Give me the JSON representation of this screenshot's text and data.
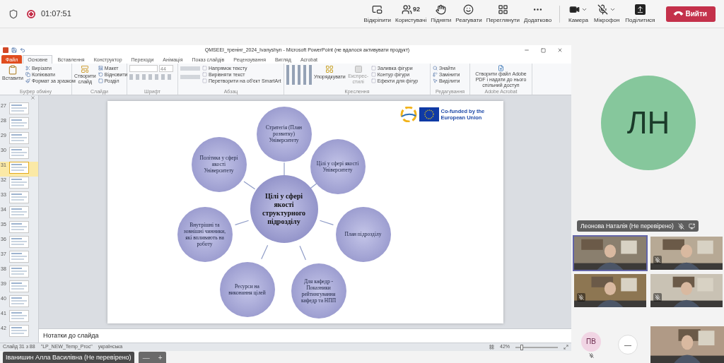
{
  "call_bar": {
    "timer": "01:07:51",
    "recording": true,
    "participant_count": "92",
    "actions": [
      "Відкріпити",
      "Користувачі",
      "Підняти",
      "Реагувати",
      "Переглянути",
      "Додатково"
    ],
    "devices": [
      {
        "label": "Камера",
        "off": false
      },
      {
        "label": "Мікрофон",
        "off": true
      },
      {
        "label": "Поділитися",
        "off": false
      }
    ],
    "leave": "Вийти"
  },
  "powerpoint": {
    "title": "QMSEEI_тренінг_2024_Ivanyshyn - Microsoft PowerPoint (не вдалося активувати продукт)",
    "tabs": [
      {
        "label": "Файл",
        "kind": "file",
        "selected": false
      },
      {
        "label": "Основне",
        "kind": "tab",
        "selected": true
      },
      {
        "label": "Вставлення",
        "kind": "tab",
        "selected": false
      },
      {
        "label": "Конструктор",
        "kind": "tab",
        "selected": false
      },
      {
        "label": "Переходи",
        "kind": "tab",
        "selected": false
      },
      {
        "label": "Анімація",
        "kind": "tab",
        "selected": false
      },
      {
        "label": "Показ слайдів",
        "kind": "tab",
        "selected": false
      },
      {
        "label": "Рецензування",
        "kind": "tab",
        "selected": false
      },
      {
        "label": "Вигляд",
        "kind": "tab",
        "selected": false
      },
      {
        "label": "Acrobat",
        "kind": "tab",
        "selected": false
      }
    ],
    "ribbon": {
      "clipboard": {
        "paste": "Вставити",
        "items": [
          "Вирізати",
          "Копіювати",
          "Формат за зразком"
        ],
        "group": "Буфер обміну"
      },
      "slides": {
        "new_slide": "Створити слайд",
        "items": [
          "Макет",
          "Відновити",
          "Розділ"
        ],
        "group": "Слайди"
      },
      "font": {
        "size": "44",
        "group": "Шрифт"
      },
      "paragraph": {
        "items": [
          "Напрямок тексту",
          "Вирівняти текст",
          "Перетворити на об'єкт SmartArt"
        ],
        "group": "Абзац"
      },
      "drawing": {
        "arrange": "Упорядкувати",
        "styles": "Експрес-стилі",
        "items": [
          "Заливка фігури",
          "Контур фігури",
          "Ефекти для фігур"
        ],
        "group": "Креслення"
      },
      "editing": {
        "items": [
          "Знайти",
          "Замінити",
          "Виділити"
        ],
        "group": "Редагування"
      },
      "acrobat": {
        "action": "Створити файл Adobe PDF і надати до нього спільний доступ",
        "group": "Adobe Acrobat"
      }
    },
    "slide_thumbnails": [
      {
        "number": "27",
        "selected": false
      },
      {
        "number": "28",
        "selected": false
      },
      {
        "number": "29",
        "selected": false
      },
      {
        "number": "30",
        "selected": false
      },
      {
        "number": "31",
        "selected": true
      },
      {
        "number": "32",
        "selected": false
      },
      {
        "number": "33",
        "selected": false
      },
      {
        "number": "34",
        "selected": false
      },
      {
        "number": "35",
        "selected": false
      },
      {
        "number": "36",
        "selected": false
      },
      {
        "number": "37",
        "selected": false
      },
      {
        "number": "38",
        "selected": false
      },
      {
        "number": "39",
        "selected": false
      },
      {
        "number": "40",
        "selected": false
      },
      {
        "number": "41",
        "selected": false
      },
      {
        "number": "42",
        "selected": false
      }
    ],
    "slide": {
      "logo_text": "Co-funded by the European Union",
      "nodes": [
        "Стратегія (План розвитку) Університету",
        "Політика у сфері якості Університету",
        "Цілі у сфері якості Університету",
        "Внутрішні та зовнішні чинники, які впливають на роботу",
        "План підрозділу",
        "Ресурси на виконання цілей",
        "Для кафедр - Показники рейтингування кафедр та НПП"
      ],
      "center": "Цілі у сфері якості структурного підрозділу"
    },
    "notes_placeholder": "Нотатки до слайда",
    "status": {
      "slide": "Слайд 31 з 88",
      "theme": "\"LP_NEW_Temp_Proc\"",
      "language": "українська",
      "zoom": "42%",
      "zoom_slider": {
        "level": 0.15
      }
    }
  },
  "presenter": {
    "name": "Іванишин Алла Василівна (Не перевірено)",
    "zoom_out": "—",
    "zoom_in": "+"
  },
  "participants": {
    "avatar_initials": "ЛН",
    "name": "Леонова Наталія (Не перевірено)",
    "tiles": [
      {
        "muted": false,
        "speaking": true
      },
      {
        "muted": true,
        "speaking": false
      },
      {
        "muted": true,
        "speaking": false
      },
      {
        "muted": true,
        "speaking": false
      }
    ],
    "others": [
      {
        "initials": "ПВ",
        "kind": "initials"
      },
      {
        "initials": "—",
        "kind": "overflow"
      }
    ]
  }
}
